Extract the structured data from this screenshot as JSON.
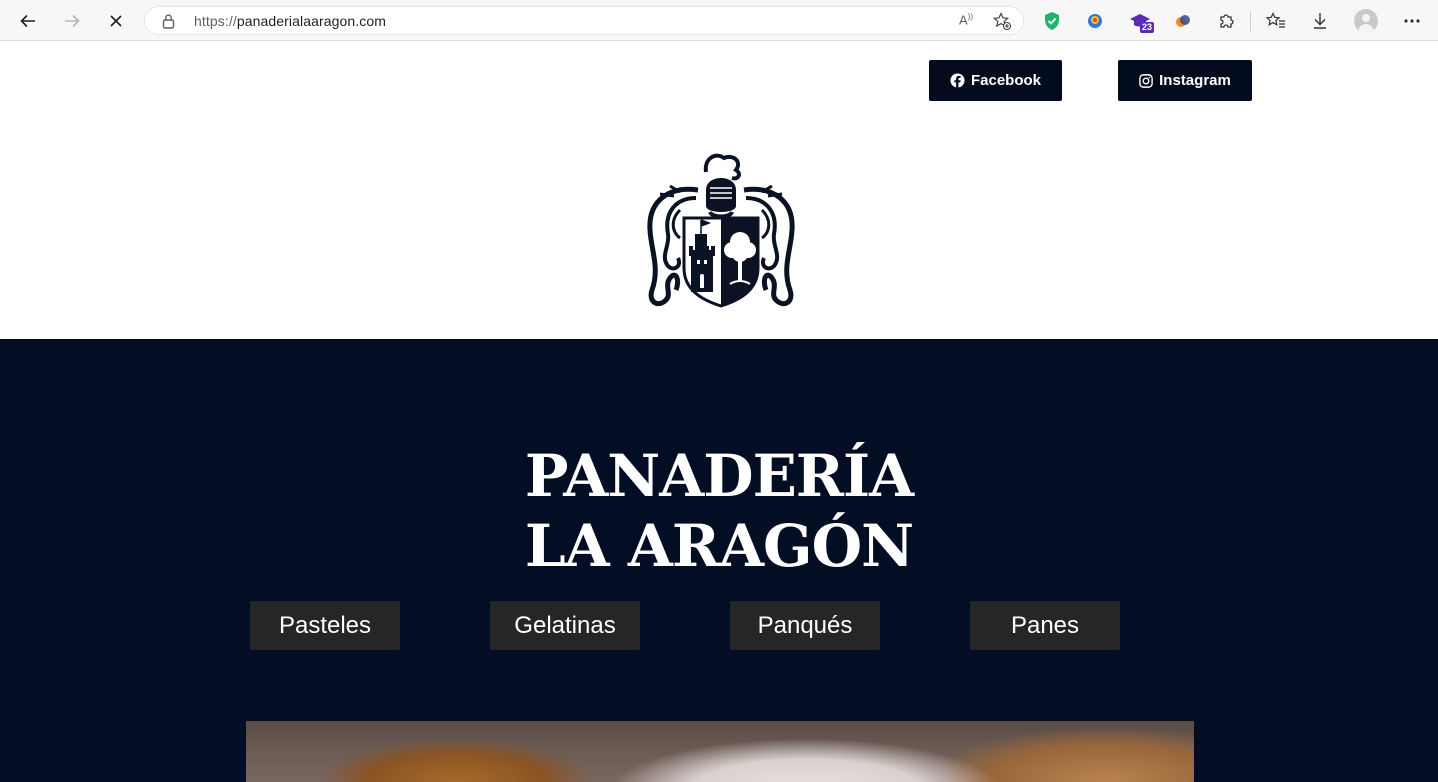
{
  "browser": {
    "url_scheme": "https://",
    "url_host": "panaderialaaragon.com",
    "read_aloud": "A",
    "extension_badge": "23",
    "icons": [
      "back-icon",
      "forward-icon",
      "stop-icon",
      "lock-icon",
      "read-aloud-icon",
      "add-favorite-icon",
      "shield-extension-icon",
      "color-extension-icon",
      "graduation-extension-icon",
      "orange-extension-icon",
      "puzzle-extensions-icon",
      "favorites-icon",
      "downloads-icon",
      "profile-avatar",
      "more-icon"
    ]
  },
  "social": {
    "facebook": "Facebook",
    "instagram": "Instagram"
  },
  "hero": {
    "title_line1": "PANADERÍA",
    "title_line2": "LA ARAGÓN",
    "categories": [
      "Pasteles",
      "Gelatinas",
      "Panqués",
      "Panes"
    ]
  },
  "colors": {
    "navy": "#030d24",
    "button_dark": "#262626",
    "social_button": "#030b1f"
  }
}
